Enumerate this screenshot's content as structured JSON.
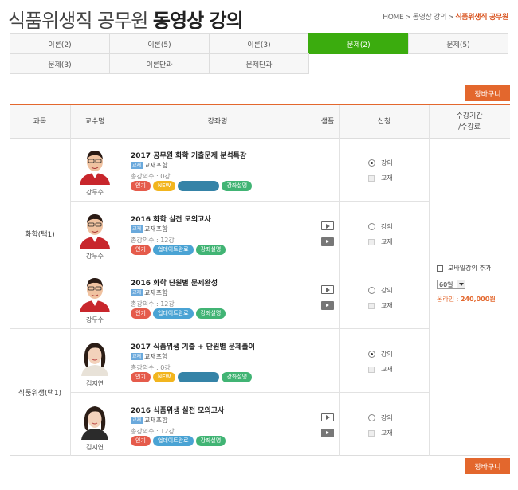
{
  "header": {
    "title_light": "식품위생직 공무원",
    "title_bold": "동영상 강의",
    "breadcrumb": [
      "HOME",
      "동영상 강의",
      "식품위생직 공무원"
    ]
  },
  "tabs": [
    {
      "label": "이론(2)",
      "active": false
    },
    {
      "label": "이론(5)",
      "active": false
    },
    {
      "label": "이론(3)",
      "active": false
    },
    {
      "label": "문제(2)",
      "active": true
    },
    {
      "label": "문제(5)",
      "active": false
    },
    {
      "label": "문제(3)",
      "active": false
    },
    {
      "label": "이론단과",
      "active": false
    },
    {
      "label": "문제단과",
      "active": false
    }
  ],
  "cart_label": "장바구니",
  "table": {
    "headers": {
      "subject": "과목",
      "professor": "교수명",
      "course": "강좌명",
      "sample": "샘플",
      "apply": "신청",
      "period": "수강기간",
      "period_sub": "/수강료"
    },
    "subjects": [
      "화학(택1)",
      "식품위생(택1)"
    ],
    "rows": [
      {
        "professor": "강두수",
        "title": "2017 공무원 화학 기출문제 분석특강",
        "material": "교재포함",
        "total": "총강의수 : 0강",
        "badges": [
          "인기",
          "NEW",
          "",
          "강좌설명"
        ],
        "has_sample": false,
        "lecture_option": "강의",
        "book_option": "교재",
        "lecture_selected": true
      },
      {
        "professor": "강두수",
        "title": "2016 화학 실전 모의고사",
        "material": "교재포함",
        "total": "총강의수 : 12강",
        "badges": [
          "인기",
          "업데이트완료",
          "강좌설명"
        ],
        "has_sample": true,
        "lecture_option": "강의",
        "book_option": "교재",
        "lecture_selected": false
      },
      {
        "professor": "강두수",
        "title": "2016 화학 단원별 문제완성",
        "material": "교재포함",
        "total": "총강의수 : 12강",
        "badges": [
          "인기",
          "업데이트완료",
          "강좌설명"
        ],
        "has_sample": true,
        "lecture_option": "강의",
        "book_option": "교재",
        "lecture_selected": false
      },
      {
        "professor": "김지연",
        "title": "2017 식품위생 기출 + 단원별 문제풀이",
        "material": "교재포함",
        "total": "총강의수 : 0강",
        "badges": [
          "인기",
          "NEW",
          "",
          "강좌설명"
        ],
        "has_sample": false,
        "lecture_option": "강의",
        "book_option": "교재",
        "lecture_selected": true
      },
      {
        "professor": "김지연",
        "title": "2016 식품위생 실전 모의고사",
        "material": "교재포함",
        "total": "총강의수 : 12강",
        "badges": [
          "인기",
          "업데이트완료",
          "강좌설명"
        ],
        "has_sample": true,
        "lecture_option": "강의",
        "book_option": "교재",
        "lecture_selected": false
      }
    ],
    "material_tag": "교재",
    "period": {
      "mobile_label": "모바일강의 추가",
      "select_value": "60일",
      "price_label": "온라인 :",
      "price": "240,000원"
    }
  },
  "colors": {
    "accent": "#e3672d",
    "tab_active": "#3bac0e"
  }
}
